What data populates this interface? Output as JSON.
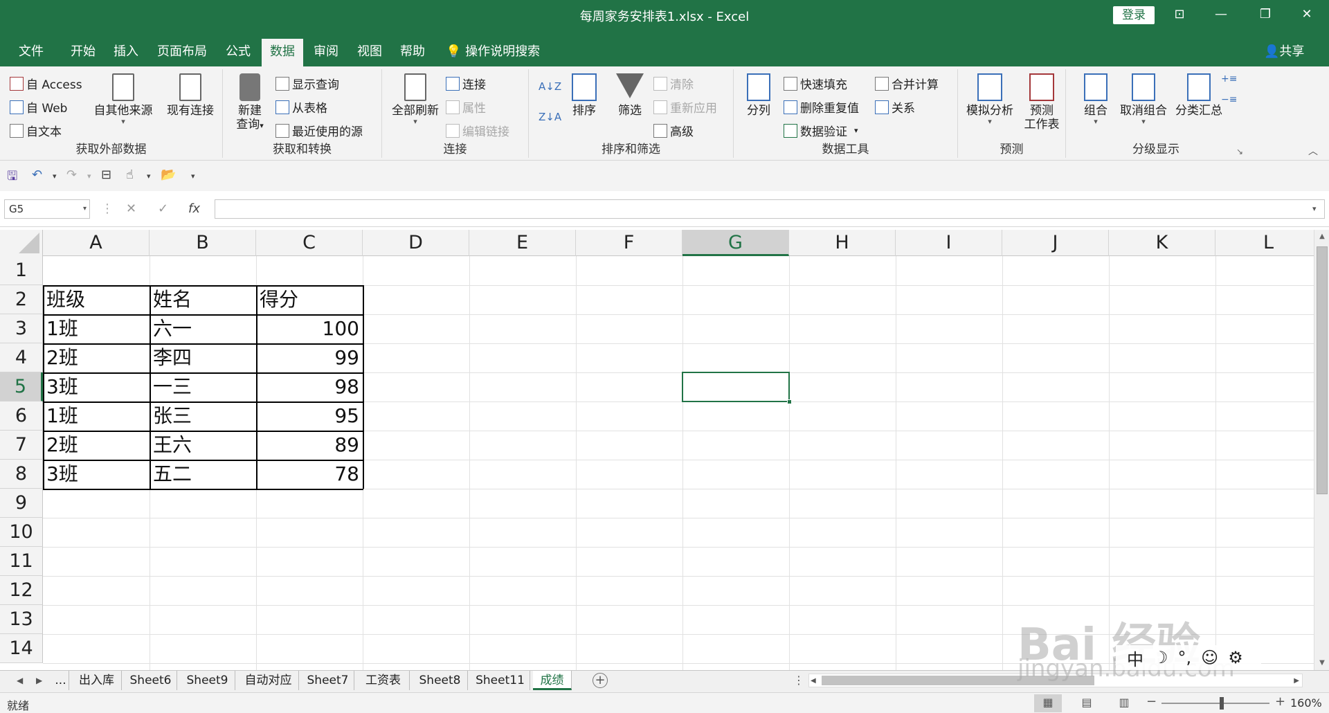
{
  "window": {
    "title": "每周家务安排表1.xlsx  -  Excel",
    "login": "登录"
  },
  "tabs": [
    "文件",
    "开始",
    "插入",
    "页面布局",
    "公式",
    "数据",
    "审阅",
    "视图",
    "帮助"
  ],
  "active_tab": "数据",
  "search_label": "操作说明搜索",
  "share_label": "共享",
  "ribbon": {
    "get_external": {
      "label": "获取外部数据",
      "access": "自 Access",
      "web": "自 Web",
      "text": "自文本",
      "other_sources": "自其他来源",
      "existing": "现有连接"
    },
    "get_transform": {
      "label": "获取和转换",
      "new_query_1": "新建",
      "new_query_2": "查询",
      "show_query": "显示查询",
      "from_table": "从表格",
      "recent_sources": "最近使用的源"
    },
    "connections": {
      "label": "连接",
      "refresh_all": "全部刷新",
      "connections": "连接",
      "properties": "属性",
      "edit_links": "编辑链接"
    },
    "sort_filter": {
      "label": "排序和筛选",
      "sort": "排序",
      "filter": "筛选",
      "clear": "清除",
      "reapply": "重新应用",
      "advanced": "高级"
    },
    "data_tools": {
      "label": "数据工具",
      "text_to_columns": "分列",
      "flash_fill": "快速填充",
      "remove_duplicates": "删除重复值",
      "data_validation": "数据验证",
      "consolidate": "合并计算",
      "relationships": "关系"
    },
    "forecast": {
      "label": "预测",
      "what_if": "模拟分析",
      "forecast_sheet_1": "预测",
      "forecast_sheet_2": "工作表"
    },
    "outline": {
      "label": "分级显示",
      "group": "组合",
      "ungroup": "取消组合",
      "subtotal": "分类汇总"
    }
  },
  "namebox": "G5",
  "fx_label": "fx",
  "columns": [
    "A",
    "B",
    "C",
    "D",
    "E",
    "F",
    "G",
    "H",
    "I",
    "J",
    "K",
    "L"
  ],
  "rows": [
    "1",
    "2",
    "3",
    "4",
    "5",
    "6",
    "7",
    "8",
    "9",
    "10",
    "11",
    "12",
    "13",
    "14"
  ],
  "selected_cell": {
    "col": "G",
    "row": "5"
  },
  "table": {
    "header": [
      "班级",
      "姓名",
      "得分"
    ],
    "data": [
      [
        "1班",
        "六一",
        "100"
      ],
      [
        "2班",
        "李四",
        "99"
      ],
      [
        "3班",
        "一三",
        "98"
      ],
      [
        "1班",
        "张三",
        "95"
      ],
      [
        "2班",
        "王六",
        "89"
      ],
      [
        "3班",
        "五二",
        "78"
      ]
    ]
  },
  "sheets": [
    "...",
    "出入库",
    "Sheet6",
    "Sheet9",
    "自动对应",
    "Sheet7",
    "工资表",
    "Sheet8",
    "Sheet11",
    "成绩"
  ],
  "active_sheet": "成绩",
  "status": {
    "ready": "就绪",
    "zoom": "160%",
    "zoom_fraction": 0.56
  },
  "watermark": {
    "line1": "Bai 经验",
    "line2": "jingyan.baidu.com"
  },
  "ime": [
    "中",
    "☽",
    "°,",
    "☺",
    "⚙"
  ]
}
